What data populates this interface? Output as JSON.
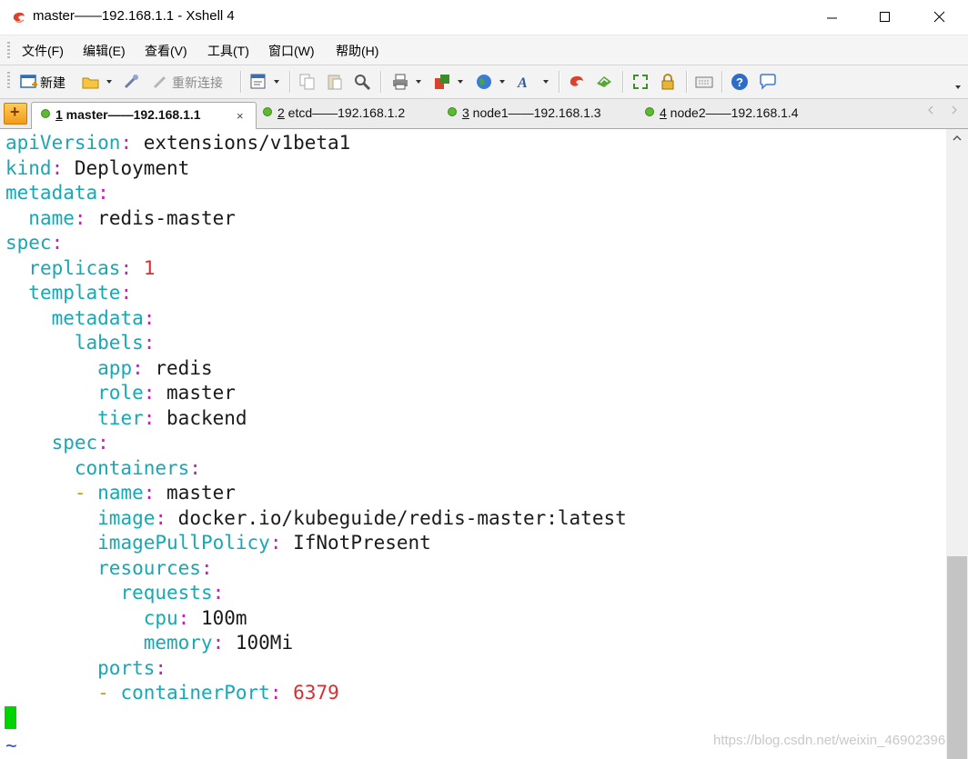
{
  "window": {
    "title": "master——192.168.1.1 - Xshell 4"
  },
  "menubar": {
    "items": [
      "文件(F)",
      "编辑(E)",
      "查看(V)",
      "工具(T)",
      "窗口(W)",
      "帮助(H)"
    ]
  },
  "toolbar": {
    "new_label": "新建",
    "reconnect_label": "重新连接"
  },
  "tabs": [
    {
      "num": "1",
      "label": " master——192.168.1.1",
      "active": true
    },
    {
      "num": "2",
      "label": " etcd——192.168.1.2",
      "active": false
    },
    {
      "num": "3",
      "label": " node1——192.168.1.3",
      "active": false
    },
    {
      "num": "4",
      "label": " node2——192.168.1.4",
      "active": false
    }
  ],
  "tab_close": "×",
  "terminal": {
    "lines": [
      [
        [
          "k",
          "apiVersion"
        ],
        [
          "c",
          ":"
        ],
        [
          "t",
          " extensions/v1beta1"
        ]
      ],
      [
        [
          "k",
          "kind"
        ],
        [
          "c",
          ":"
        ],
        [
          "t",
          " Deployment"
        ]
      ],
      [
        [
          "k",
          "metadata"
        ],
        [
          "c",
          ":"
        ]
      ],
      [
        [
          "t",
          "  "
        ],
        [
          "k",
          "name"
        ],
        [
          "c",
          ":"
        ],
        [
          "t",
          " redis-master"
        ]
      ],
      [
        [
          "k",
          "spec"
        ],
        [
          "c",
          ":"
        ]
      ],
      [
        [
          "t",
          "  "
        ],
        [
          "k",
          "replicas"
        ],
        [
          "c",
          ":"
        ],
        [
          "t",
          " "
        ],
        [
          "n",
          "1"
        ]
      ],
      [
        [
          "t",
          "  "
        ],
        [
          "k",
          "template"
        ],
        [
          "c",
          ":"
        ]
      ],
      [
        [
          "t",
          "    "
        ],
        [
          "k",
          "metadata"
        ],
        [
          "c",
          ":"
        ]
      ],
      [
        [
          "t",
          "      "
        ],
        [
          "k",
          "labels"
        ],
        [
          "c",
          ":"
        ]
      ],
      [
        [
          "t",
          "        "
        ],
        [
          "k",
          "app"
        ],
        [
          "c",
          ":"
        ],
        [
          "t",
          " redis"
        ]
      ],
      [
        [
          "t",
          "        "
        ],
        [
          "k",
          "role"
        ],
        [
          "c",
          ":"
        ],
        [
          "t",
          " master"
        ]
      ],
      [
        [
          "t",
          "        "
        ],
        [
          "k",
          "tier"
        ],
        [
          "c",
          ":"
        ],
        [
          "t",
          " backend"
        ]
      ],
      [
        [
          "t",
          "    "
        ],
        [
          "k",
          "spec"
        ],
        [
          "c",
          ":"
        ]
      ],
      [
        [
          "t",
          "      "
        ],
        [
          "k",
          "containers"
        ],
        [
          "c",
          ":"
        ]
      ],
      [
        [
          "t",
          "      "
        ],
        [
          "d",
          "-"
        ],
        [
          "t",
          " "
        ],
        [
          "k",
          "name"
        ],
        [
          "c",
          ":"
        ],
        [
          "t",
          " master"
        ]
      ],
      [
        [
          "t",
          "        "
        ],
        [
          "k",
          "image"
        ],
        [
          "c",
          ":"
        ],
        [
          "t",
          " docker.io/kubeguide/redis-master:latest"
        ]
      ],
      [
        [
          "t",
          "        "
        ],
        [
          "k",
          "imagePullPolicy"
        ],
        [
          "c",
          ":"
        ],
        [
          "t",
          " IfNotPresent"
        ]
      ],
      [
        [
          "t",
          "        "
        ],
        [
          "k",
          "resources"
        ],
        [
          "c",
          ":"
        ]
      ],
      [
        [
          "t",
          "          "
        ],
        [
          "k",
          "requests"
        ],
        [
          "c",
          ":"
        ]
      ],
      [
        [
          "t",
          "            "
        ],
        [
          "k",
          "cpu"
        ],
        [
          "c",
          ":"
        ],
        [
          "t",
          " 100m"
        ]
      ],
      [
        [
          "t",
          "            "
        ],
        [
          "k",
          "memory"
        ],
        [
          "c",
          ":"
        ],
        [
          "t",
          " 100Mi"
        ]
      ],
      [
        [
          "t",
          "        "
        ],
        [
          "k",
          "ports"
        ],
        [
          "c",
          ":"
        ]
      ],
      [
        [
          "t",
          "        "
        ],
        [
          "d",
          "-"
        ],
        [
          "t",
          " "
        ],
        [
          "k",
          "containerPort"
        ],
        [
          "c",
          ":"
        ],
        [
          "t",
          " "
        ],
        [
          "n",
          "6379"
        ]
      ]
    ],
    "tilde": "~",
    "colors": {
      "key": "#17a8b3",
      "colon": "#c020b8",
      "number": "#d62f2f",
      "dash": "#c9a000",
      "cursor": "#00d400"
    }
  },
  "watermark": "https://blog.csdn.net/weixin_46902396"
}
